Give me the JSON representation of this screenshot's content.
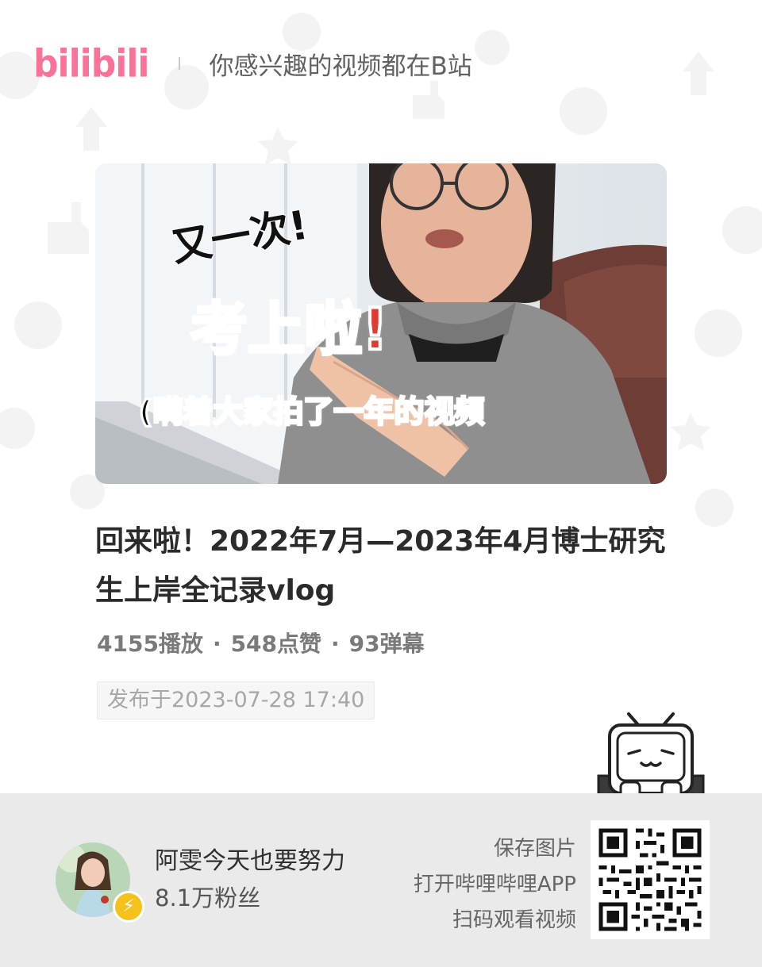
{
  "brand": {
    "logo_text": "bilibili",
    "color": "#fb7299"
  },
  "header": {
    "slogan": "你感兴趣的视频都在B站"
  },
  "cover": {
    "line1": "又一次!",
    "line2": "考上啦!",
    "line3": "(瞒着大家拍了一年的视频"
  },
  "video": {
    "title": "回来啦！2022年7月—2023年4月博士研究生上岸全记录vlog",
    "stats": {
      "plays": "4155播放",
      "likes": "548点赞",
      "danmaku": "93弹幕",
      "separator": "·"
    },
    "publish_date": "发布于2023-07-28 17:40"
  },
  "author": {
    "name": "阿雯今天也要努力",
    "followers": "8.1万粉丝",
    "badge_icon": "lightning-icon"
  },
  "footer": {
    "hint_lines": [
      "保存图片",
      "打开哔哩哔哩APP",
      "扫码观看视频"
    ]
  },
  "icons": {
    "qr": "qr-code-icon",
    "mascot": "tv-mascot-icon"
  }
}
